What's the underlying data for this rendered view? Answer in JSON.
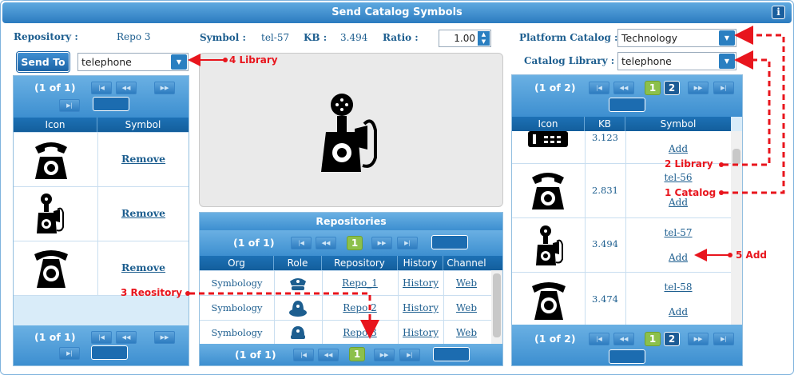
{
  "window": {
    "title": "Send Catalog Symbols",
    "info_icon": "i"
  },
  "top": {
    "repository_label": "Repository :",
    "repository_value": "Repo 3",
    "symbol_label": "Symbol :",
    "symbol_value": "tel-57",
    "kb_label": "KB :",
    "kb_value": "3.494",
    "ratio_label": "Ratio :",
    "ratio_value": "1.00"
  },
  "right_top": {
    "platform_label": "Platform Catalog :",
    "platform_value": "Technology",
    "library_label": "Catalog Library :",
    "library_value": "telephone"
  },
  "send": {
    "button": "Send To",
    "library_value": "telephone"
  },
  "left_panel": {
    "pager_top": "(1 of 1)",
    "pager_bottom": "(1 of 1)",
    "col_icon": "Icon",
    "col_symbol": "Symbol",
    "rows": [
      {
        "icon": "classic-phone-icon",
        "action": "Remove"
      },
      {
        "icon": "candlestick-phone-icon",
        "action": "Remove"
      },
      {
        "icon": "rotary-phone-icon",
        "action": "Remove"
      }
    ]
  },
  "repositories": {
    "title": "Repositories",
    "pager_top": "(1 of 1)",
    "pager_bottom": "(1 of 1)",
    "page": "1",
    "cols": [
      "Org",
      "Role",
      "Repository",
      "History",
      "Channel"
    ],
    "rows": [
      {
        "org": "Symbology",
        "role": "police-hat-icon",
        "repo": "Repo_1",
        "history": "History",
        "channel": "Web"
      },
      {
        "org": "Symbology",
        "role": "bucket-hat-icon",
        "repo": "Repo 2",
        "history": "History",
        "channel": "Web"
      },
      {
        "org": "Symbology",
        "role": "cap-icon",
        "repo": "Repo 3",
        "history": "History",
        "channel": "Web"
      }
    ]
  },
  "right_panel": {
    "pager_top": "(1 of 2)",
    "pager_bottom": "(1 of 2)",
    "pages": [
      "1",
      "2"
    ],
    "cols": [
      "Icon",
      "KB",
      "Symbol"
    ],
    "rows": [
      {
        "icon": "keypad-phone-icon",
        "kb": "3.123",
        "name": "",
        "action": "Add"
      },
      {
        "icon": "classic-phone-icon",
        "kb": "2.831",
        "name": "tel-56",
        "action": "Add"
      },
      {
        "icon": "candlestick-phone-icon",
        "kb": "3.494",
        "name": "tel-57",
        "action": "Add"
      },
      {
        "icon": "rotary-phone-icon",
        "kb": "3.474",
        "name": "tel-58",
        "action": "Add"
      }
    ]
  },
  "annotations": {
    "a1": "4 Library",
    "a2": "2 Library",
    "a3": "1 Catalog",
    "a4": "5 Add",
    "a5": "3 Reository"
  },
  "colors": {
    "accent": "#2a7fc1",
    "annotation": "#e8151d",
    "active_page": "#8cc04b"
  }
}
